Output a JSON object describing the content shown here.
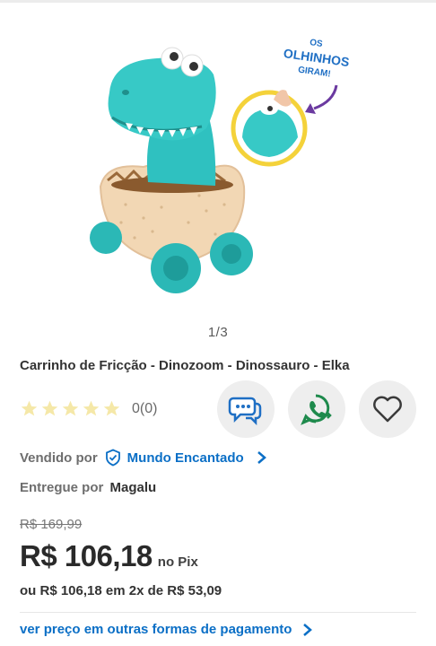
{
  "gallery": {
    "image_alt": "Carrinho de Fricção Dinozoom",
    "callout": {
      "line1": "OS",
      "line2": "OLHINHOS",
      "line3": "GIRAM!"
    },
    "pager": "1/3"
  },
  "product": {
    "title": "Carrinho de Fricção - Dinozoom - Dinossauro - Elka",
    "rating": {
      "stars": 0,
      "max_stars": 5,
      "count_label": "0(0)"
    }
  },
  "actions": {
    "chat_icon": "chat-bubbles-icon",
    "whatsapp_icon": "whatsapp-icon",
    "favorite_icon": "heart-icon"
  },
  "seller": {
    "label": "Vendido por",
    "name": "Mundo Encantado"
  },
  "delivery": {
    "label": "Entregue por",
    "carrier": "Magalu"
  },
  "pricing": {
    "old_price": "R$ 169,99",
    "price": "R$ 106,18",
    "price_method": "no Pix",
    "installments": "ou R$ 106,18 em 2x de R$ 53,09",
    "payment_link": "ver preço em outras formas de pagamento"
  },
  "colors": {
    "accent_blue": "#0b6fc6",
    "star_empty": "#f5e8a8",
    "whatsapp_green": "#1e8a4c",
    "chat_blue": "#1f6fc4"
  }
}
